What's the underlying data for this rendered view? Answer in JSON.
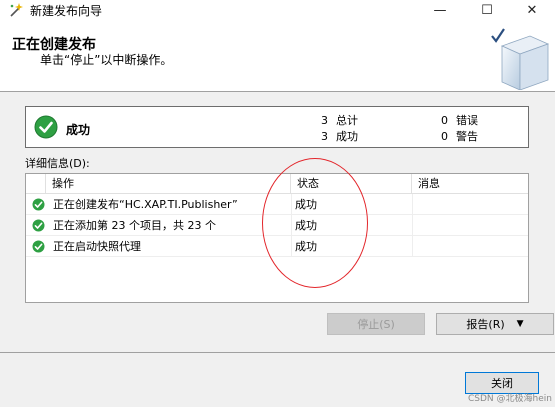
{
  "window": {
    "title": "新建发布向导",
    "min_icon": "—",
    "max_icon": "☐",
    "close_icon": "✕"
  },
  "header": {
    "title": "正在创建发布",
    "subtitle": "单击“停止”以中断操作。"
  },
  "summary": {
    "status": "成功",
    "total_count": "3",
    "total_label": "总计",
    "success_count": "3",
    "success_label": "成功",
    "error_count": "0",
    "error_label": "错误",
    "warning_count": "0",
    "warning_label": "警告"
  },
  "details": {
    "label": "详细信息(D):",
    "columns": [
      "操作",
      "状态",
      "消息"
    ],
    "rows": [
      {
        "action": "正在创建发布“HC.XAP.TI.Publisher”",
        "status": "成功",
        "message": ""
      },
      {
        "action": "正在添加第 23 个项目，共 23 个",
        "status": "成功",
        "message": ""
      },
      {
        "action": "正在启动快照代理",
        "status": "成功",
        "message": ""
      }
    ]
  },
  "buttons": {
    "stop": "停止(S)",
    "report": "报告(R)",
    "report_arrow": "▼",
    "close": "关闭"
  },
  "watermark": "CSDN @北极海hein",
  "colors": {
    "success_green": "#2ea043",
    "annotation_red": "#e3262b",
    "accent_blue": "#0078d7"
  }
}
